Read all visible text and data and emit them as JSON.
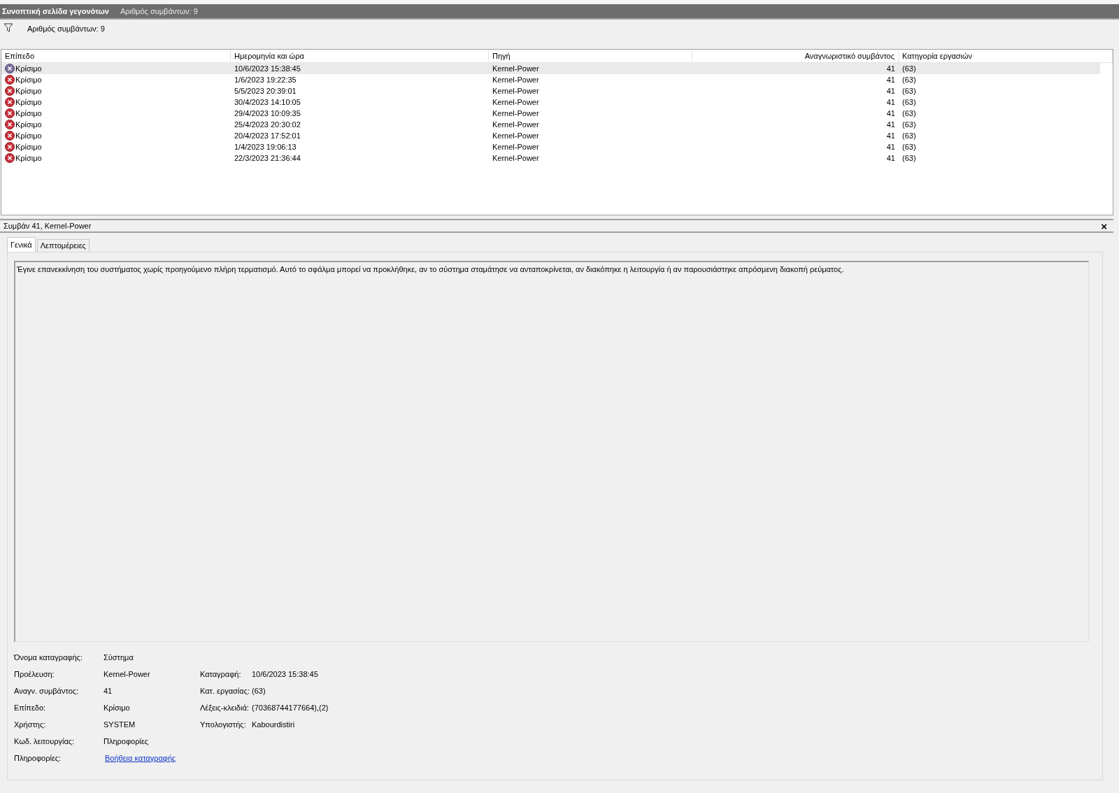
{
  "header": {
    "title": "Συνοπτική σελίδα γεγονότων",
    "count": "Αριθμός συμβάντων: 9"
  },
  "filter": {
    "text": "Αριθμός συμβάντων: 9"
  },
  "table": {
    "columns": [
      "Επίπεδο",
      "Ημερομηνία και ώρα",
      "Πηγή",
      "Αναγνωριστικό συμβάντος",
      "Κατηγορία εργασιών"
    ],
    "rows": [
      {
        "level": "Κρίσιμο",
        "date": "10/6/2023 15:38:45",
        "source": "Kernel-Power",
        "id": "41",
        "category": "(63)",
        "selected": true
      },
      {
        "level": "Κρίσιμο",
        "date": "1/6/2023 19:22:35",
        "source": "Kernel-Power",
        "id": "41",
        "category": "(63)",
        "selected": false
      },
      {
        "level": "Κρίσιμο",
        "date": "5/5/2023 20:39:01",
        "source": "Kernel-Power",
        "id": "41",
        "category": "(63)",
        "selected": false
      },
      {
        "level": "Κρίσιμο",
        "date": "30/4/2023 14:10:05",
        "source": "Kernel-Power",
        "id": "41",
        "category": "(63)",
        "selected": false
      },
      {
        "level": "Κρίσιμο",
        "date": "29/4/2023 10:09:35",
        "source": "Kernel-Power",
        "id": "41",
        "category": "(63)",
        "selected": false
      },
      {
        "level": "Κρίσιμο",
        "date": "25/4/2023 20:30:02",
        "source": "Kernel-Power",
        "id": "41",
        "category": "(63)",
        "selected": false
      },
      {
        "level": "Κρίσιμο",
        "date": "20/4/2023 17:52:01",
        "source": "Kernel-Power",
        "id": "41",
        "category": "(63)",
        "selected": false
      },
      {
        "level": "Κρίσιμο",
        "date": "1/4/2023 19:06:13",
        "source": "Kernel-Power",
        "id": "41",
        "category": "(63)",
        "selected": false
      },
      {
        "level": "Κρίσιμο",
        "date": "22/3/2023 21:36:44",
        "source": "Kernel-Power",
        "id": "41",
        "category": "(63)",
        "selected": false
      }
    ]
  },
  "detail": {
    "title": "Συμβάν 41, Kernel-Power",
    "close": "×",
    "tabs": [
      {
        "label": "Γενικά",
        "selected": true
      },
      {
        "label": "Λεπτομέρειες",
        "selected": false
      }
    ],
    "description": "Έγινε επανεκκίνηση του συστήματος χωρίς προηγούμενο πλήρη τερματισμό. Αυτό το σφάλμα μπορεί να προκλήθηκε, αν το σύστημα σταμάτησε να ανταποκρίνεται, αν διακόπηκε η λειτουργία ή αν παρουσιάστηκε απρόσμενη διακοπή ρεύματος.",
    "properties": [
      {
        "label": "Όνομα καταγραφής:",
        "value": "Σύστημα",
        "kind": "text"
      },
      {
        "label": "Προέλευση:",
        "value": "Kernel-Power",
        "kind": "text",
        "extra_label": "Καταγραφή:",
        "extra_value": "10/6/2023 15:38:45"
      },
      {
        "label": "Αναγν. συμβάντος:",
        "value": "41",
        "kind": "text",
        "extra_label": "Κατ. εργασίας:",
        "extra_value": "(63)"
      },
      {
        "label": "Επίπεδο:",
        "value": "Κρίσιμο",
        "kind": "text",
        "extra_label": "Λέξεις-κλειδιά:",
        "extra_value": "(70368744177664),(2)"
      },
      {
        "label": "Χρήστης:",
        "value": "SYSTEM",
        "kind": "text",
        "extra_label": "Υπολογιστής:",
        "extra_value": "Kabourdistiri"
      },
      {
        "label": "Κωδ. λειτουργίας:",
        "value": "Πληροφορίες",
        "kind": "text"
      },
      {
        "label": "Πληροφορίες:",
        "value": "Βοήθεια καταγραφής",
        "kind": "link"
      }
    ]
  }
}
